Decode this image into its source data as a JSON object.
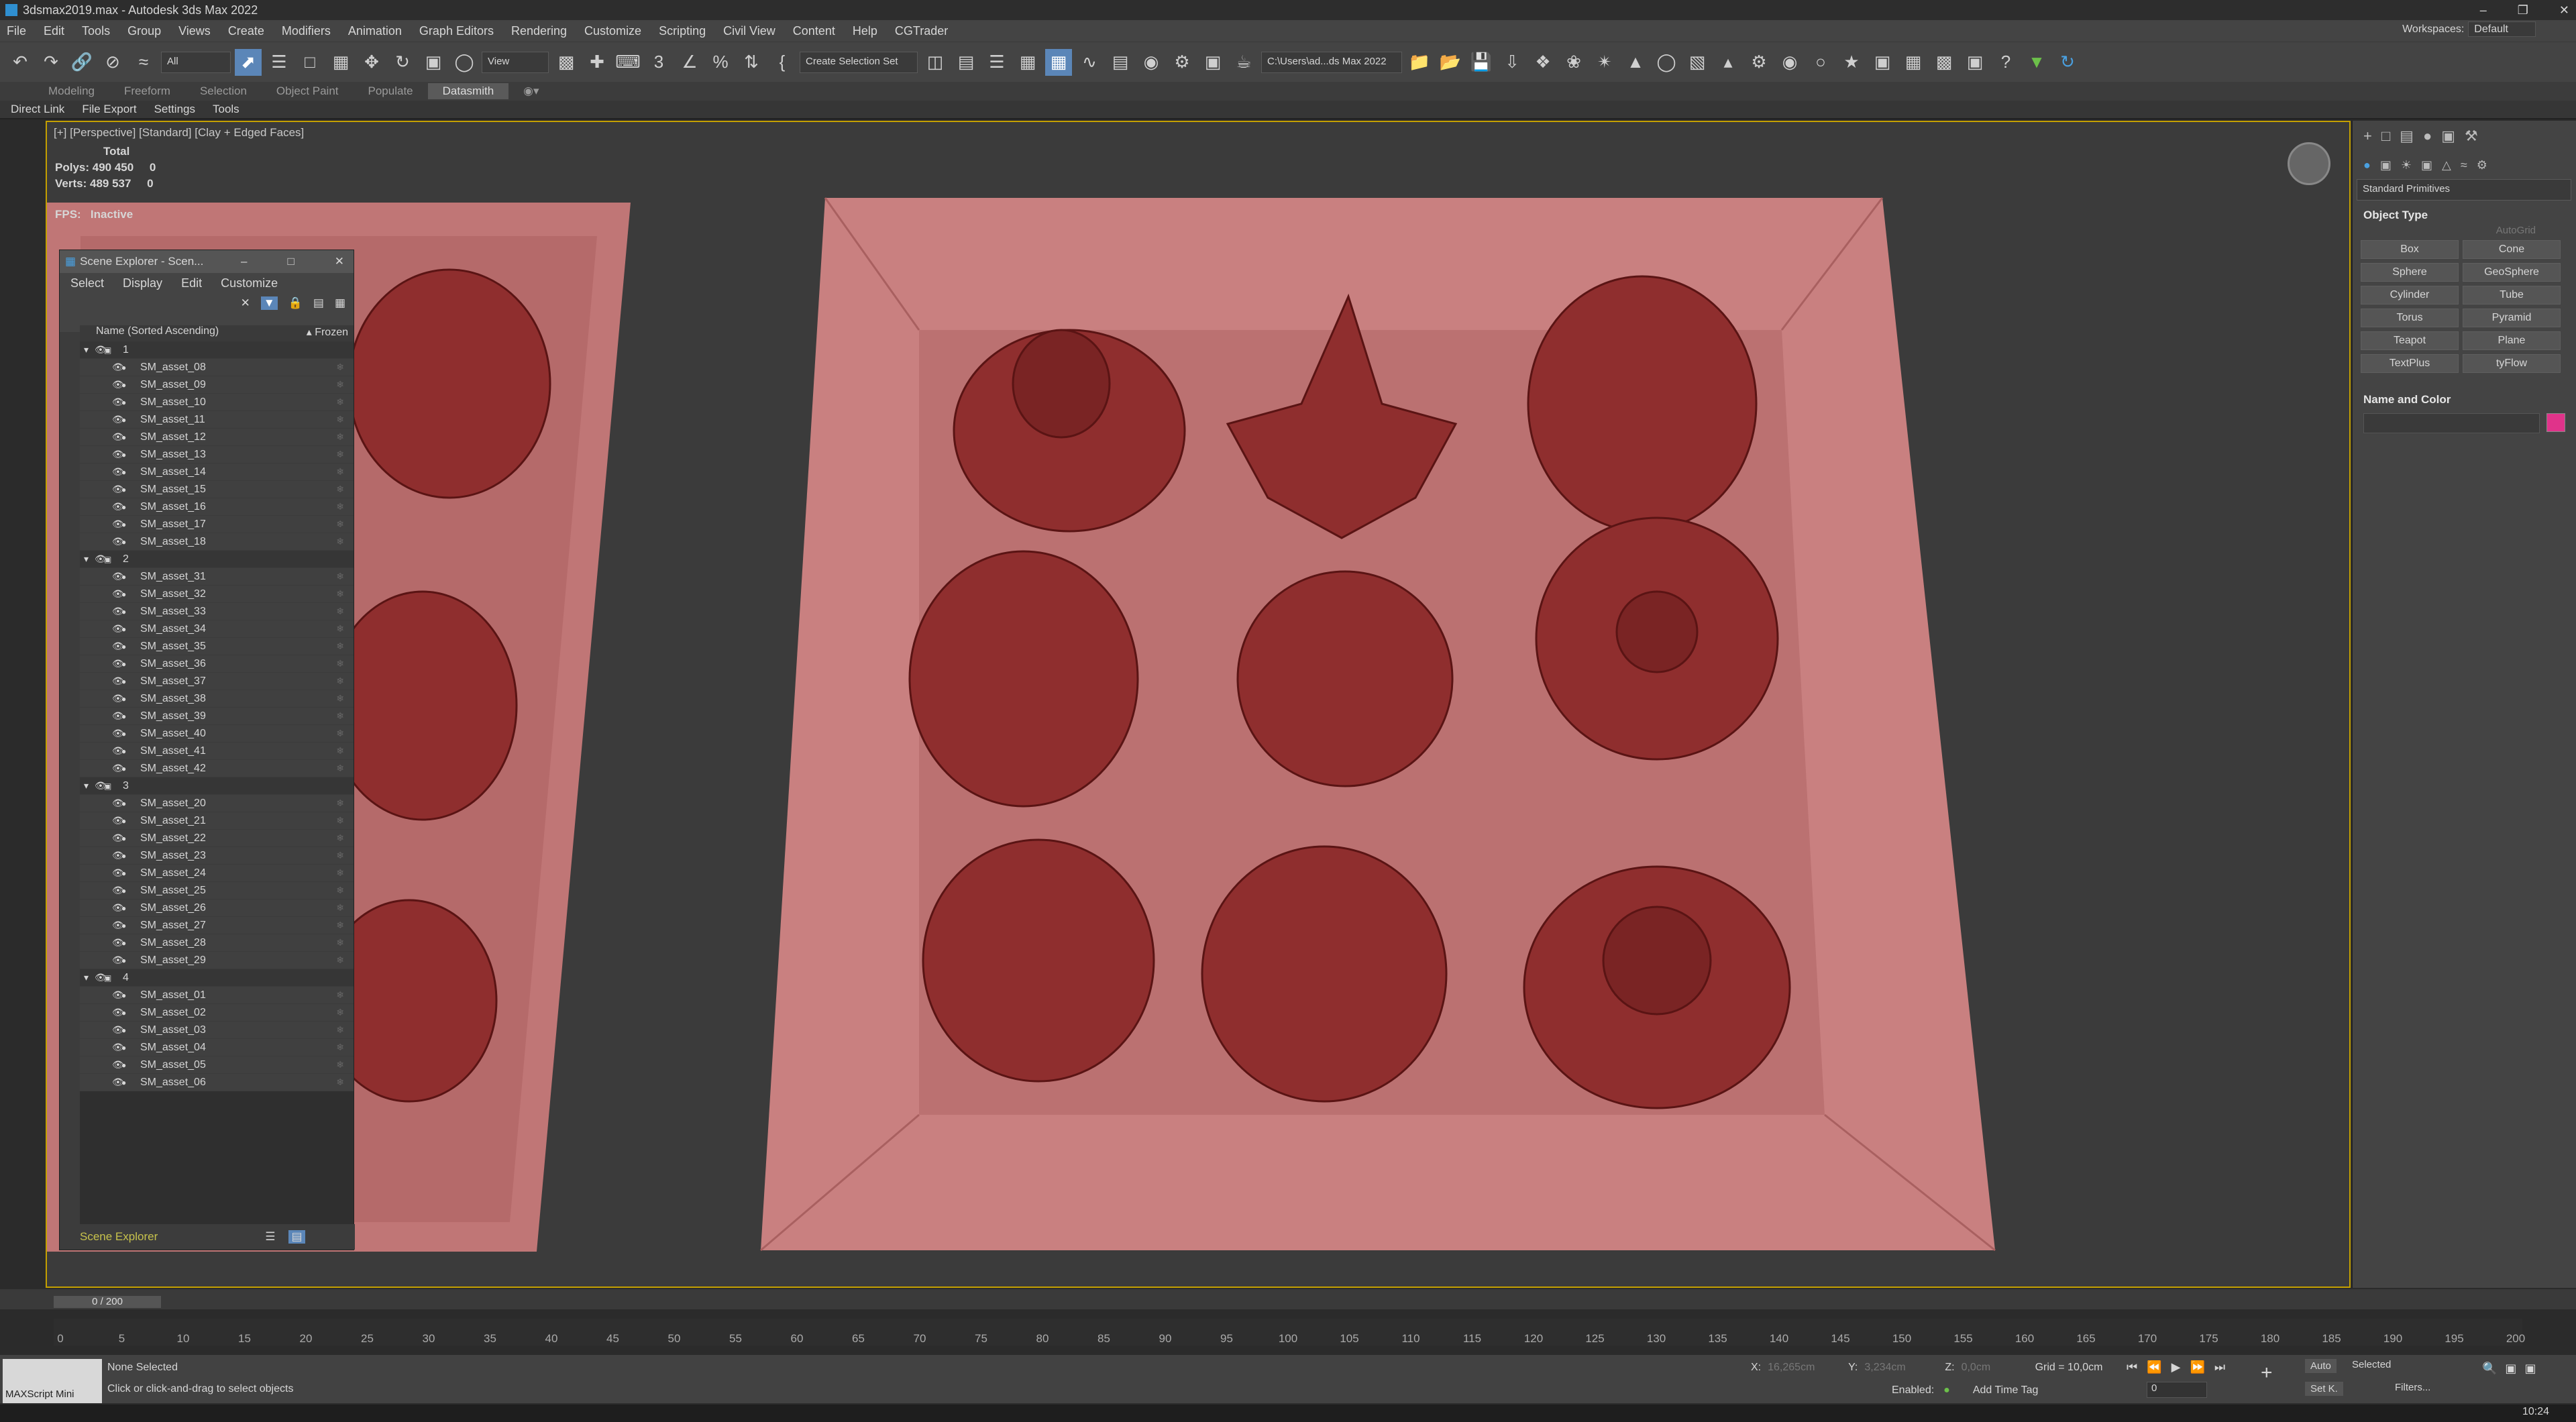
{
  "window": {
    "title": "3dsmax2019.max - Autodesk 3ds Max 2022"
  },
  "menu": [
    "File",
    "Edit",
    "Tools",
    "Group",
    "Views",
    "Create",
    "Modifiers",
    "Animation",
    "Graph Editors",
    "Rendering",
    "Customize",
    "Scripting",
    "Civil View",
    "Content",
    "Help",
    "CGTrader"
  ],
  "workspace": {
    "label": "Workspaces:",
    "value": "Default"
  },
  "toolbar": {
    "filter": "All",
    "refsys": "View",
    "selset": "Create Selection Set",
    "path": "C:\\Users\\ad...ds Max 2022"
  },
  "ribbon": {
    "tabs": [
      "Modeling",
      "Freeform",
      "Selection",
      "Object Paint",
      "Populate",
      "Datasmith"
    ],
    "active": "Datasmith"
  },
  "subbar": [
    "Direct Link",
    "File Export",
    "Settings",
    "Tools"
  ],
  "viewport": {
    "label": "[+] [Perspective] [Standard] [Clay + Edged Faces]",
    "stats": {
      "total": "Total",
      "polys_label": "Polys:",
      "polys": "490 450",
      "polys_sel": "0",
      "verts_label": "Verts:",
      "verts": "489 537",
      "verts_sel": "0"
    },
    "fps_label": "FPS:",
    "fps": "Inactive"
  },
  "scene_explorer": {
    "title": "Scene Explorer - Scen...",
    "menu": [
      "Select",
      "Display",
      "Edit",
      "Customize"
    ],
    "column": "Name (Sorted Ascending)",
    "frozen": "▴ Frozen",
    "groups": [
      {
        "name": "1",
        "items": [
          "SM_asset_08",
          "SM_asset_09",
          "SM_asset_10",
          "SM_asset_11",
          "SM_asset_12",
          "SM_asset_13",
          "SM_asset_14",
          "SM_asset_15",
          "SM_asset_16",
          "SM_asset_17",
          "SM_asset_18"
        ]
      },
      {
        "name": "2",
        "items": [
          "SM_asset_31",
          "SM_asset_32",
          "SM_asset_33",
          "SM_asset_34",
          "SM_asset_35",
          "SM_asset_36",
          "SM_asset_37",
          "SM_asset_38",
          "SM_asset_39",
          "SM_asset_40",
          "SM_asset_41",
          "SM_asset_42"
        ]
      },
      {
        "name": "3",
        "items": [
          "SM_asset_20",
          "SM_asset_21",
          "SM_asset_22",
          "SM_asset_23",
          "SM_asset_24",
          "SM_asset_25",
          "SM_asset_26",
          "SM_asset_27",
          "SM_asset_28",
          "SM_asset_29"
        ]
      },
      {
        "name": "4",
        "items": [
          "SM_asset_01",
          "SM_asset_02",
          "SM_asset_03",
          "SM_asset_04",
          "SM_asset_05",
          "SM_asset_06"
        ]
      }
    ],
    "footer": "Scene Explorer"
  },
  "command_panel": {
    "category": "Standard Primitives",
    "object_type": "Object Type",
    "autogrid": "AutoGrid",
    "primitives": [
      "Box",
      "Cone",
      "Sphere",
      "GeoSphere",
      "Cylinder",
      "Tube",
      "Torus",
      "Pyramid",
      "Teapot",
      "Plane",
      "TextPlus",
      "tyFlow"
    ],
    "name_color": "Name and Color",
    "color": "#e0338a"
  },
  "timeline": {
    "frame": "0 / 200",
    "ticks": [
      "0",
      "5",
      "10",
      "15",
      "20",
      "25",
      "30",
      "35",
      "40",
      "45",
      "50",
      "55",
      "60",
      "65",
      "70",
      "75",
      "80",
      "85",
      "90",
      "95",
      "100",
      "105",
      "110",
      "115",
      "120",
      "125",
      "130",
      "135",
      "140",
      "145",
      "150",
      "155",
      "160",
      "165",
      "170",
      "175",
      "180",
      "185",
      "190",
      "195",
      "200"
    ]
  },
  "status": {
    "selection": "None Selected",
    "hint": "Click or click-and-drag to select objects",
    "maxscript": "MAXScript Mini",
    "x_label": "X:",
    "x": "16,265cm",
    "y_label": "Y:",
    "y": "3,234cm",
    "z_label": "Z:",
    "z": "0,0cm",
    "grid": "Grid = 10,0cm",
    "enabled": "Enabled:",
    "add_time_tag": "Add Time Tag",
    "auto": "Auto",
    "setk": "Set K.",
    "selected": "Selected",
    "filters": "Filters...",
    "frame_field": "0",
    "clock": "10:24"
  },
  "colors": {
    "accent": "#5b86b8",
    "viewport_border": "#c4a000",
    "box": "#c87a7a",
    "asset": "#8a2a2a"
  }
}
